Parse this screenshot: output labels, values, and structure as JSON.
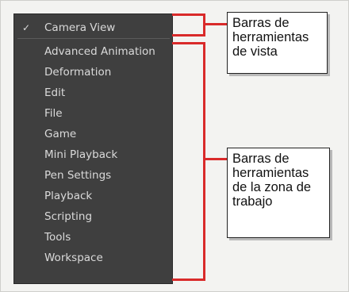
{
  "menu": {
    "checked_item": {
      "check": "✓",
      "label": "Camera View"
    },
    "items": [
      {
        "label": "Advanced Animation"
      },
      {
        "label": "Deformation"
      },
      {
        "label": "Edit"
      },
      {
        "label": "File"
      },
      {
        "label": "Game"
      },
      {
        "label": "Mini Playback"
      },
      {
        "label": "Pen Settings"
      },
      {
        "label": "Playback"
      },
      {
        "label": "Scripting"
      },
      {
        "label": "Tools"
      },
      {
        "label": "Workspace"
      }
    ]
  },
  "callouts": {
    "view_toolbars": {
      "line1": "Barras de",
      "line2": "herramientas",
      "line3": "de vista"
    },
    "workspace_toolbars": {
      "line1": "Barras de",
      "line2": "herramientas",
      "line3": "de la zona de",
      "line4": "trabajo"
    }
  },
  "colors": {
    "menu_background": "#3f3f3f",
    "menu_text": "#dadada",
    "bracket": "#d92a2a",
    "panel_background": "#f3f3f1"
  }
}
